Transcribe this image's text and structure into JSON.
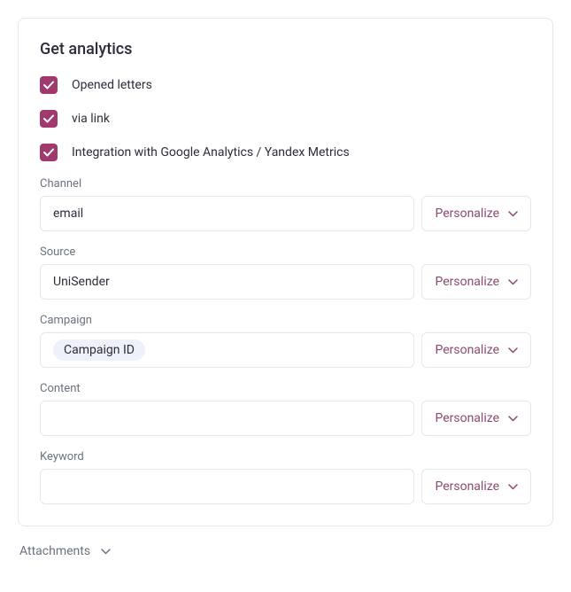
{
  "panel": {
    "title": "Get analytics",
    "checkboxes": [
      {
        "label": "Opened letters",
        "checked": true
      },
      {
        "label": "via link",
        "checked": true
      },
      {
        "label": "Integration with Google Analytics / Yandex Metrics",
        "checked": true
      }
    ],
    "fields": {
      "channel": {
        "label": "Channel",
        "value": "email",
        "personalize": "Personalize"
      },
      "source": {
        "label": "Source",
        "value": "UniSender",
        "personalize": "Personalize"
      },
      "campaign": {
        "label": "Campaign",
        "chip": "Campaign ID",
        "personalize": "Personalize"
      },
      "content": {
        "label": "Content",
        "value": "",
        "personalize": "Personalize"
      },
      "keyword": {
        "label": "Keyword",
        "value": "",
        "personalize": "Personalize"
      }
    }
  },
  "attachments": {
    "label": "Attachments"
  },
  "colors": {
    "checkbox_bg": "#a03a6e",
    "personalize_text": "#8a4a73"
  }
}
